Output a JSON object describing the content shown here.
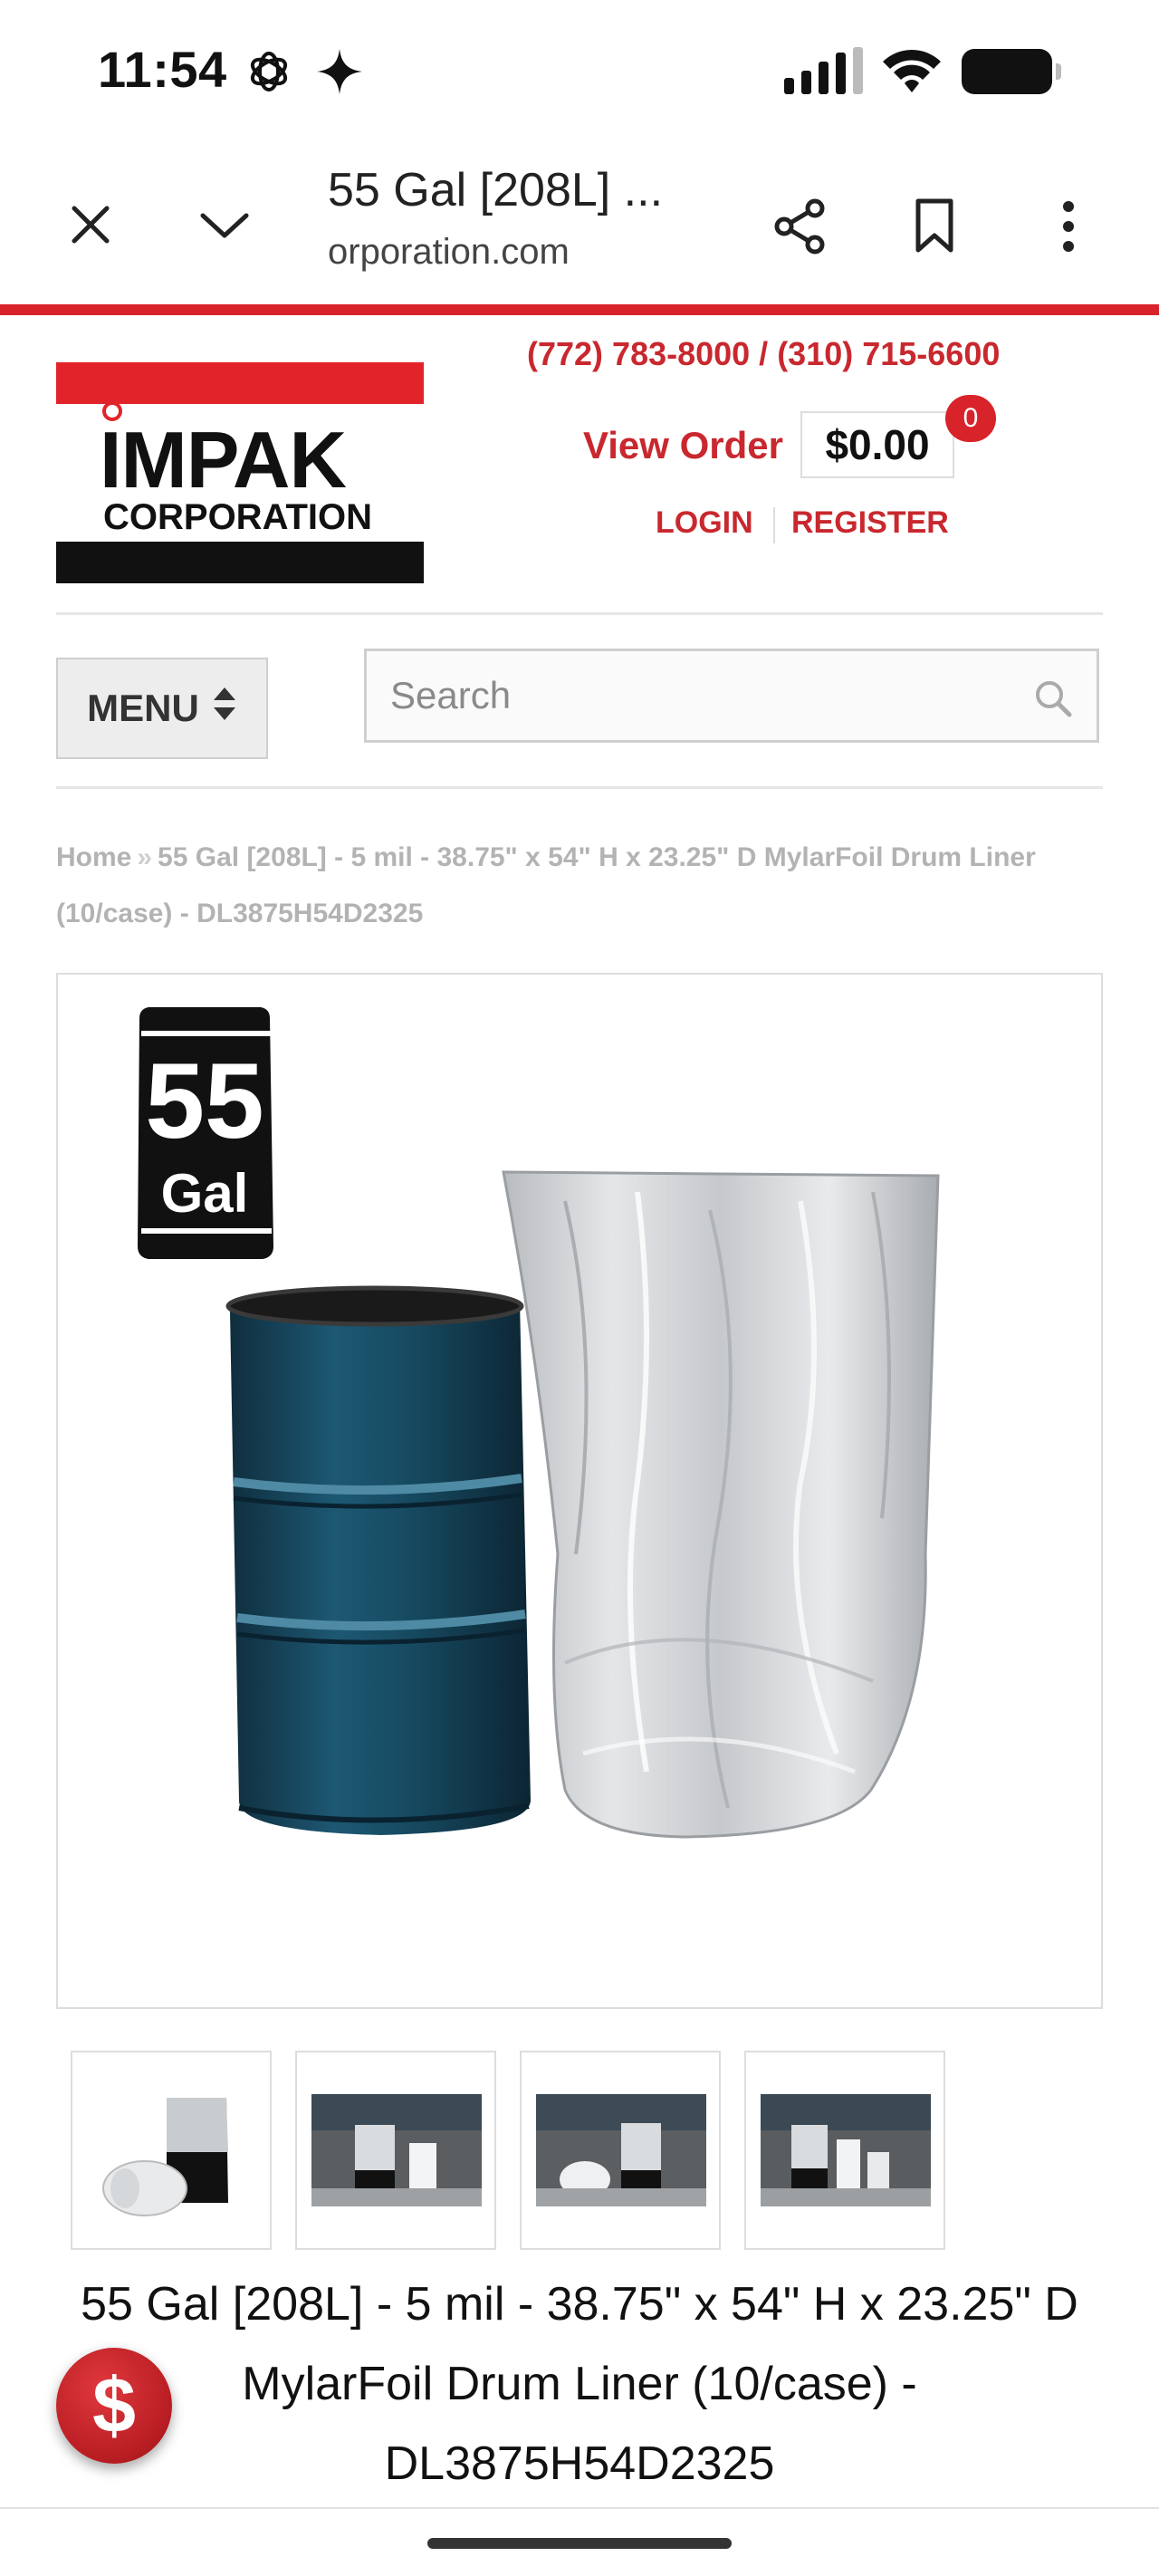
{
  "status_bar": {
    "time": "11:54",
    "icons": [
      "ai-assistant-icon",
      "sparkle-icon",
      "cellular-signal-icon",
      "wifi-icon",
      "battery-icon"
    ]
  },
  "browser": {
    "tab_title": "55 Gal [208L] ...",
    "url": "orporation.com",
    "buttons": [
      "close-icon",
      "chevron-down-icon",
      "share-icon",
      "bookmark-icon",
      "more-vertical-icon"
    ],
    "accent_color": "#d8232a"
  },
  "header": {
    "logo_text_1": "IMPAK",
    "logo_text_2": "CORPORATION",
    "phones": "(772) 783-8000 / (310) 715-6600",
    "view_order": "View Order",
    "cart_total": "$0.00",
    "cart_count": "0",
    "login": "LOGIN",
    "register": "REGISTER"
  },
  "nav": {
    "menu_label": "MENU",
    "search_placeholder": "Search"
  },
  "breadcrumb": {
    "home": "Home",
    "separator": "»",
    "current": "55 Gal [208L] - 5 mil - 38.75\" x 54\" H x 23.25\" D MylarFoil Drum Liner (10/case) - DL3875H54D2325"
  },
  "product": {
    "badge_number": "55",
    "badge_unit": "Gal",
    "title": "55 Gal [208L] - 5 mil - 38.75\" x 54\" H x 23.25\" D MylarFoil Drum Liner (10/case) - DL3875H54D2325",
    "thumbnails": [
      "liner-thumbnail-1",
      "liner-thumbnail-2",
      "liner-thumbnail-3",
      "liner-thumbnail-4"
    ]
  },
  "fab": {
    "symbol": "$"
  }
}
